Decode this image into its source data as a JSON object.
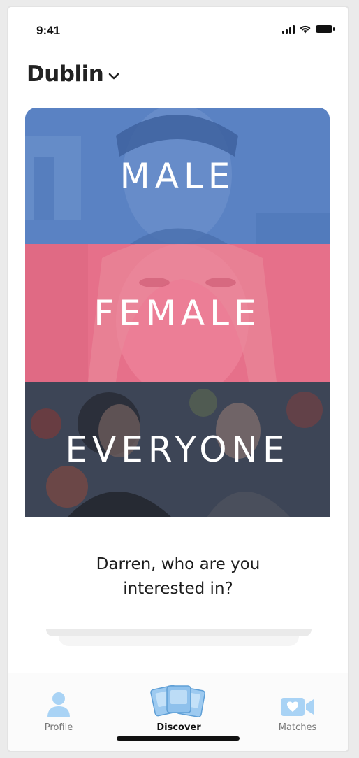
{
  "status_bar": {
    "time": "9:41"
  },
  "header": {
    "location": "Dublin"
  },
  "choices": [
    {
      "label": "MALE",
      "color": "#5a82c3"
    },
    {
      "label": "FEMALE",
      "color": "#e6708a"
    },
    {
      "label": "EVERYONE",
      "color": "#3d4556"
    }
  ],
  "question": {
    "line1": "Darren, who are you",
    "line2": "interested in?"
  },
  "tabs": [
    {
      "label": "Profile",
      "icon": "person-icon",
      "active": false
    },
    {
      "label": "Discover",
      "icon": "cards-icon",
      "active": true
    },
    {
      "label": "Matches",
      "icon": "video-heart-icon",
      "active": false
    }
  ],
  "colors": {
    "accent_blue": "#9dcaf0",
    "tab_active": "#111111",
    "tab_inactive": "#777777"
  }
}
